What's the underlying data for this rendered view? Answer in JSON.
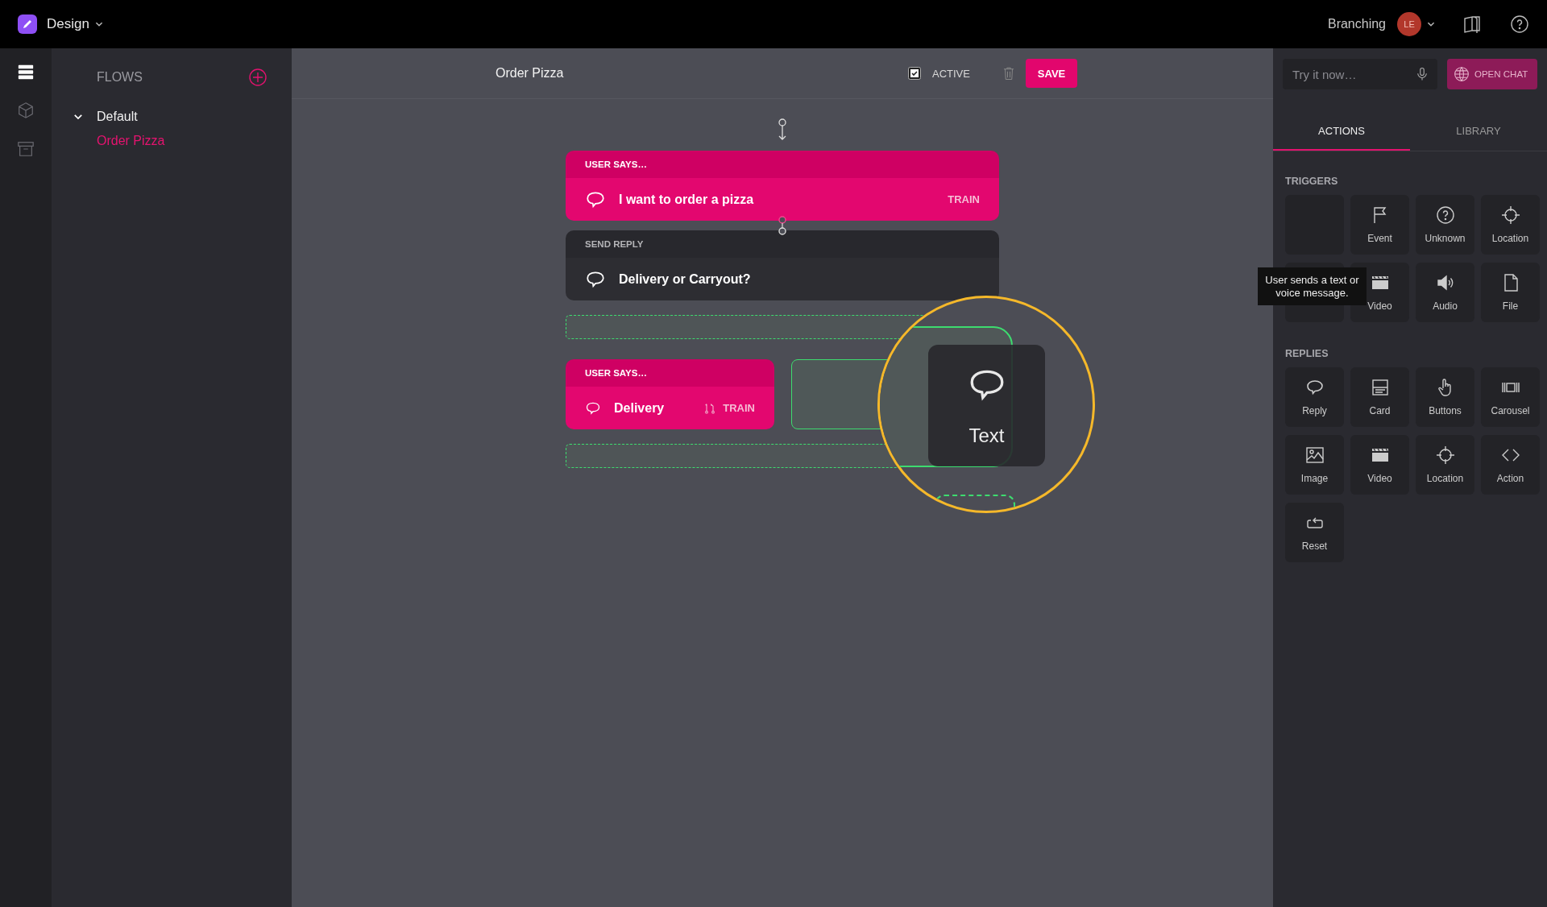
{
  "app": {
    "title": "Design"
  },
  "account": {
    "project": "Branching",
    "avatar": "LE"
  },
  "rail": [
    {
      "selected": true
    },
    {
      "selected": false
    },
    {
      "selected": false
    }
  ],
  "sidebar": {
    "title": "FLOWS",
    "groups": [
      {
        "label": "Default",
        "expanded": true,
        "children": [
          {
            "label": "Order Pizza",
            "selected": true
          }
        ]
      }
    ]
  },
  "flow": {
    "title": "Order Pizza",
    "active": {
      "label": "ACTIVE",
      "checked": true
    },
    "save": "SAVE"
  },
  "canvas_items": [
    {
      "kind": "user",
      "heading": "USER SAYS…",
      "text": "I want to order a pizza",
      "train": "TRAIN"
    },
    {
      "kind": "reply",
      "heading": "SEND REPLY",
      "text": "Delivery or Carryout?"
    },
    {
      "kind": "dropzone"
    },
    {
      "kind": "row",
      "children": [
        {
          "kind": "user",
          "heading": "USER SAYS…",
          "text": "Delivery",
          "train": "TRAIN"
        },
        {
          "kind": "target"
        }
      ]
    },
    {
      "kind": "dropzone"
    }
  ],
  "drag_preview": {
    "label": "Text"
  },
  "chat": {
    "placeholder": "Try it now…",
    "open_chat": "OPEN CHAT"
  },
  "tabs": [
    {
      "label": "ACTIONS",
      "selected": true
    },
    {
      "label": "LIBRARY",
      "selected": false
    }
  ],
  "sections": [
    {
      "title": "TRIGGERS",
      "tiles": [
        {
          "kind": "blank"
        },
        {
          "kind": "action",
          "label": "Event"
        },
        {
          "kind": "action",
          "label": "Unknown"
        },
        {
          "kind": "action",
          "label": "Location"
        },
        {
          "kind": "blank"
        },
        {
          "kind": "action",
          "label": "Video"
        },
        {
          "kind": "action",
          "label": "Audio"
        },
        {
          "kind": "action",
          "label": "File"
        }
      ]
    },
    {
      "title": "REPLIES",
      "tiles": [
        {
          "kind": "action",
          "label": "Reply"
        },
        {
          "kind": "action",
          "label": "Card"
        },
        {
          "kind": "action",
          "label": "Buttons"
        },
        {
          "kind": "action",
          "label": "Carousel"
        },
        {
          "kind": "action",
          "label": "Image"
        },
        {
          "kind": "action",
          "label": "Video"
        },
        {
          "kind": "action",
          "label": "Location"
        },
        {
          "kind": "action",
          "label": "Action"
        },
        {
          "kind": "action",
          "label": "Reset"
        }
      ]
    }
  ],
  "tooltip": {
    "text": "User sends a text or voice message."
  }
}
